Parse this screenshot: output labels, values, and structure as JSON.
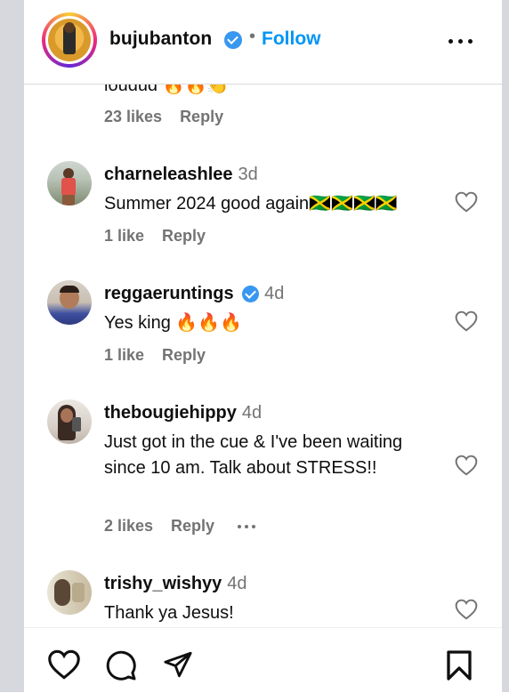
{
  "header": {
    "username": "bujubanton",
    "separator": "•",
    "follow_label": "Follow",
    "verified_icon": "verified-badge-icon",
    "more_icon": "more-horizontal-icon"
  },
  "previous_comment": {
    "partial_text": "loudud 🔥🔥👏",
    "likes": "23 likes",
    "reply_label": "Reply"
  },
  "comments": [
    {
      "username": "charneleashlee",
      "time": "3d",
      "verified": false,
      "text": "Summer 2024 good again🇯🇲🇯🇲🇯🇲🇯🇲",
      "likes": "1 like",
      "reply_label": "Reply"
    },
    {
      "username": "reggaeruntings",
      "time": "4d",
      "verified": true,
      "text": "Yes king 🔥🔥🔥",
      "likes": "1 like",
      "reply_label": "Reply"
    },
    {
      "username": "thebougiehippy",
      "time": "4d",
      "verified": false,
      "text": "Just got in the cue & I've been waiting since 10 am. Talk about STRESS!!",
      "likes": "2 likes",
      "reply_label": "Reply"
    },
    {
      "username": "trishy_wishyy",
      "time": "4d",
      "verified": false,
      "text": "Thank ya Jesus!"
    }
  ],
  "actions": {
    "like_icon": "heart-icon",
    "comment_icon": "comment-icon",
    "share_icon": "send-icon",
    "save_icon": "bookmark-icon"
  },
  "colors": {
    "follow": "#0095f6",
    "verified": "#3897f0",
    "muted": "#737373"
  }
}
